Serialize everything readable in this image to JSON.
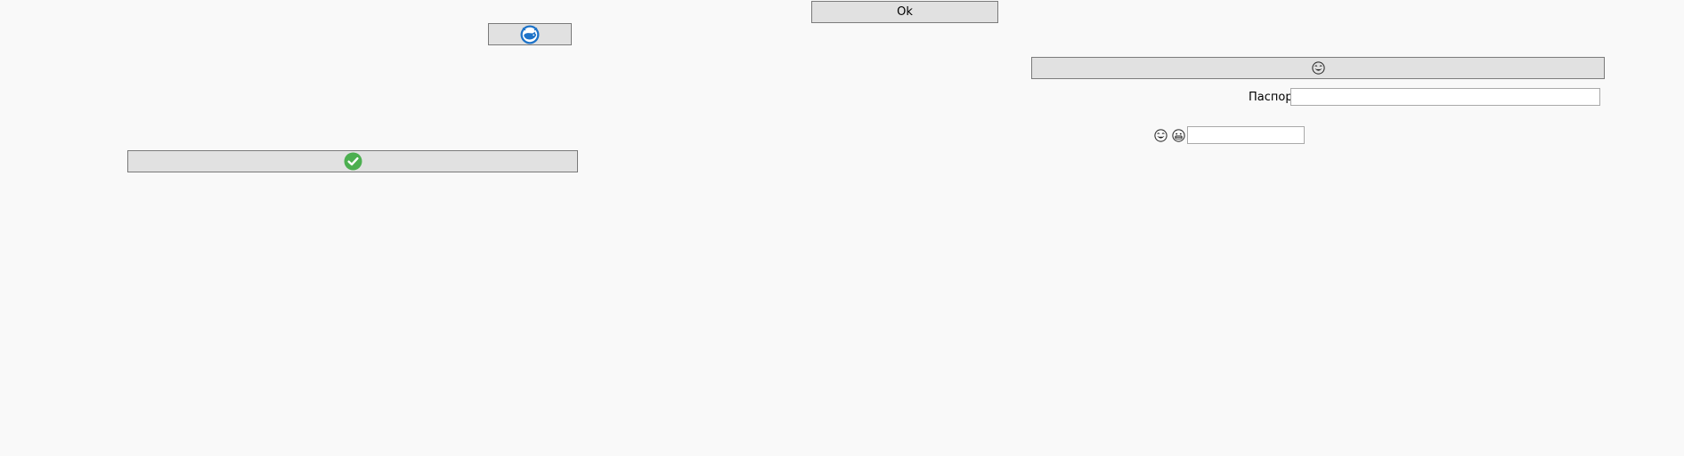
{
  "window": {
    "ok_button_label": "Ok",
    "passport_label": "Паспорт",
    "passport_field_value": "",
    "small_field_value": ""
  },
  "icons": {
    "whale_button_icon": "docker-whale-icon",
    "check_button_icon": "green-check-icon",
    "face_button_icon": "laughing-face-icon",
    "face_label_icons": [
      "laughing-face-icon",
      "grinning-face-icon"
    ]
  },
  "colors": {
    "background": "#f9f9f9",
    "button_face": "#e1e1e1",
    "button_border": "#7a7a7a",
    "input_border": "#a9a9a9",
    "whale_blue": "#1e73c8",
    "check_green": "#4caf50"
  }
}
